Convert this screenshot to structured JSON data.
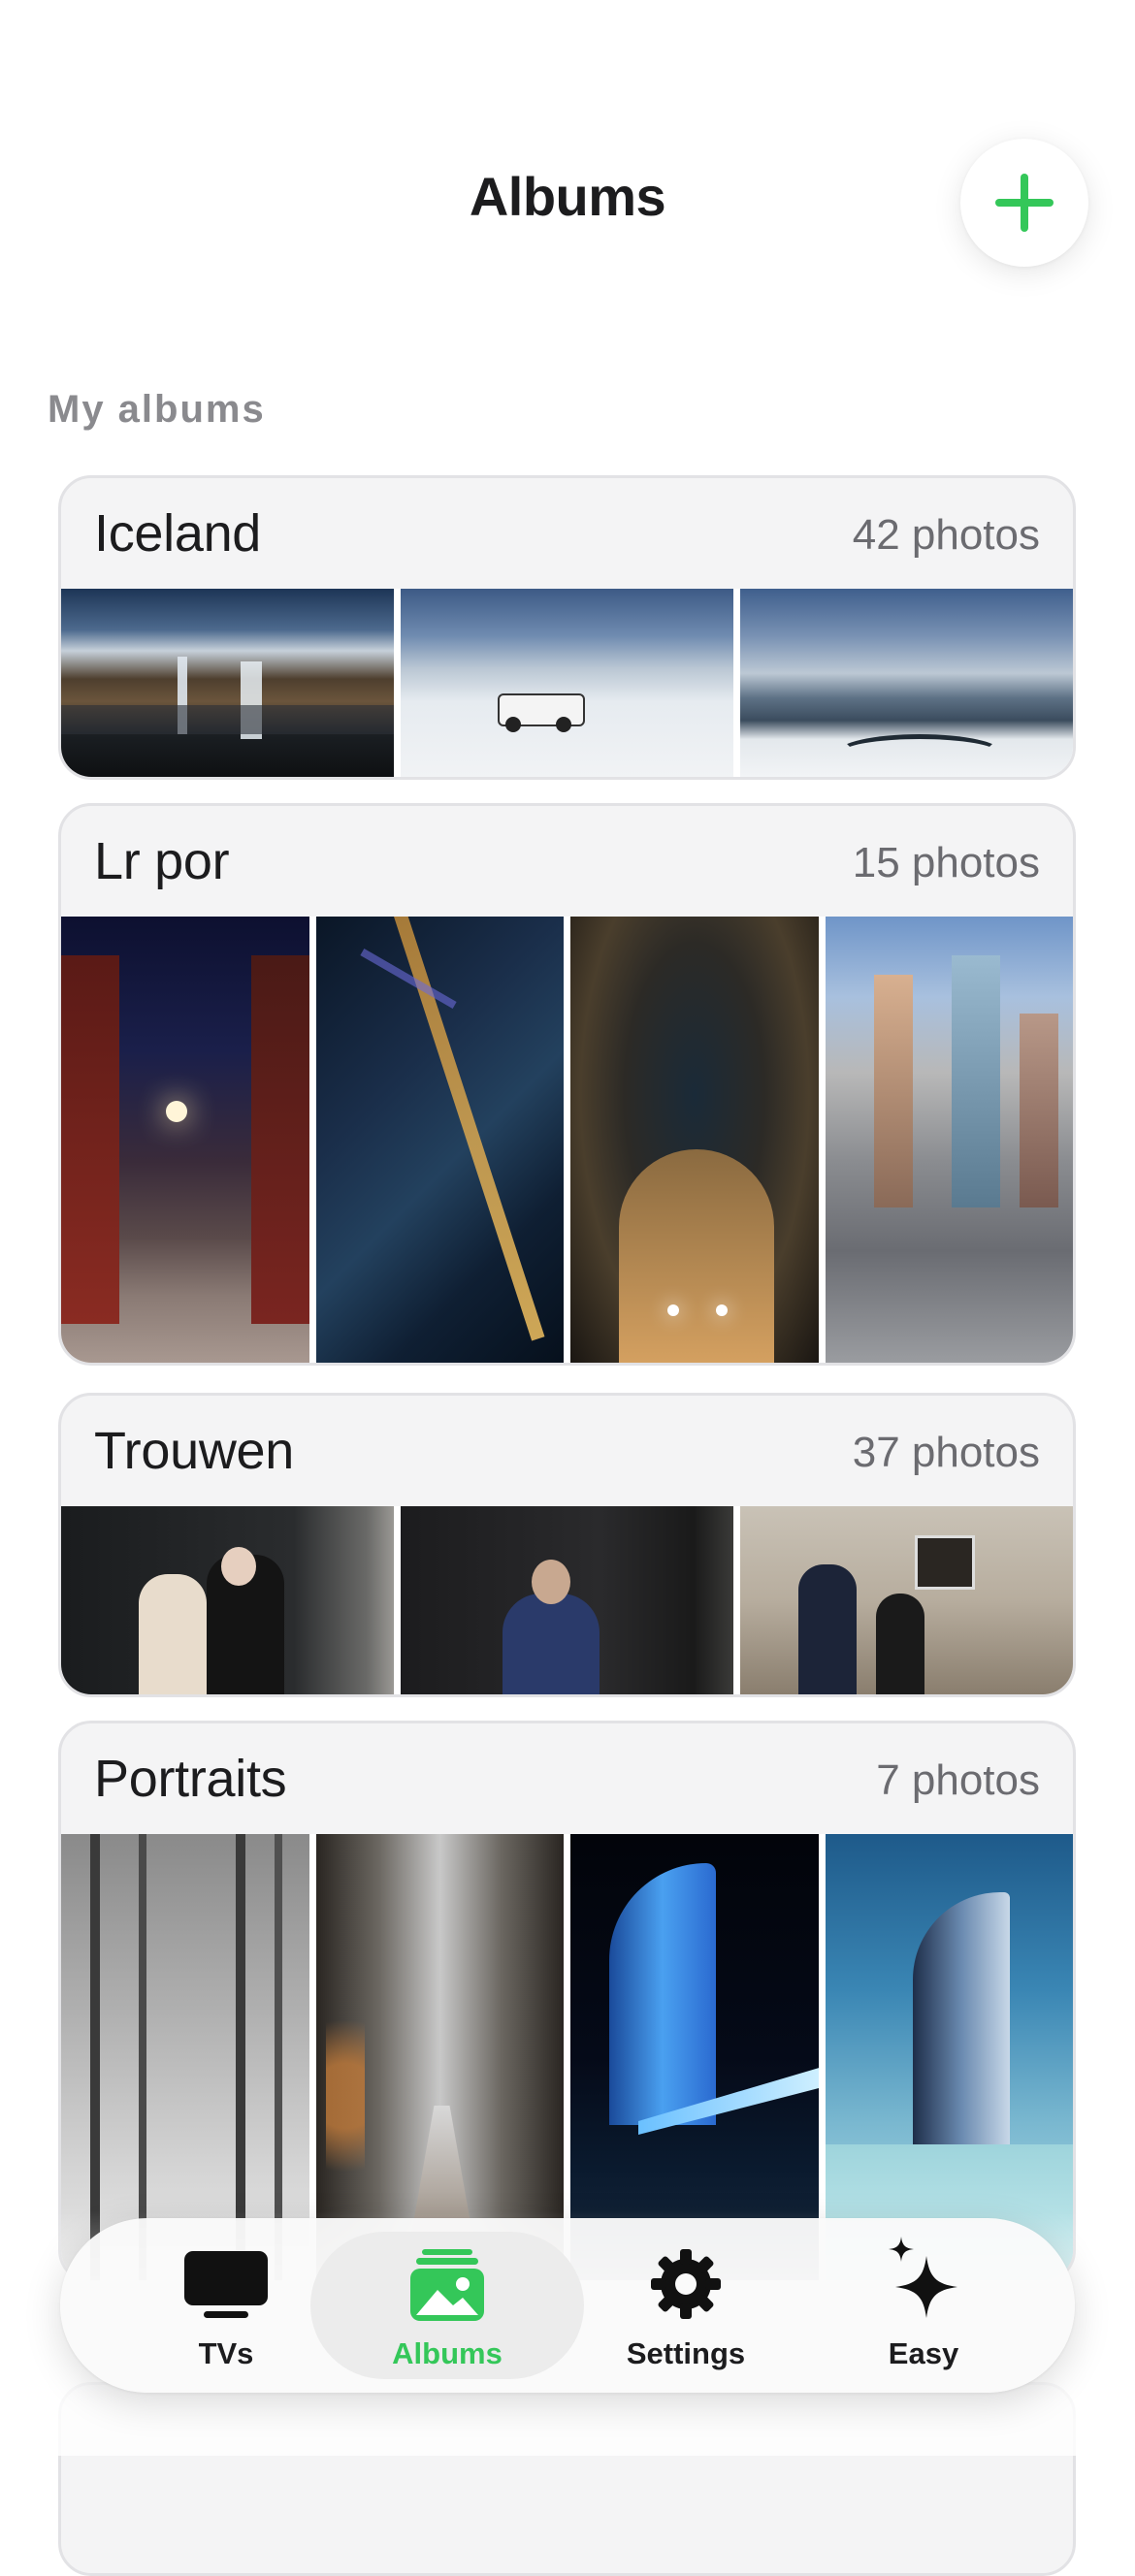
{
  "header": {
    "title": "Albums",
    "add_icon": "plus-icon",
    "accent_color": "#34c759"
  },
  "section": {
    "label": "My albums"
  },
  "albums": [
    {
      "name": "Iceland",
      "count": "42 photos",
      "thumbnails": [
        "waterfall-landscape",
        "jeep-on-snow",
        "snowy-coastline"
      ]
    },
    {
      "name": "Lr por",
      "count": "15 photos",
      "thumbnails": [
        "brooklyn-bridge-street-night",
        "aerial-city-night",
        "skyscrapers-looking-up",
        "times-square-aerial"
      ]
    },
    {
      "name": "Trouwen",
      "count": "37 photos",
      "thumbnails": [
        "wedding-couple",
        "man-with-phone",
        "couple-singing"
      ]
    },
    {
      "name": "Portraits",
      "count": "7 photos",
      "thumbnails": [
        "foggy-trees",
        "forest-path",
        "burj-al-arab-night",
        "burj-al-arab-day"
      ]
    }
  ],
  "tabbar": {
    "tabs": [
      {
        "label": "TVs",
        "icon": "tv-icon",
        "active": false
      },
      {
        "label": "Albums",
        "icon": "photo-stack-icon",
        "active": true
      },
      {
        "label": "Settings",
        "icon": "gear-icon",
        "active": false
      },
      {
        "label": "Easy",
        "icon": "sparkles-icon",
        "active": false
      }
    ]
  }
}
